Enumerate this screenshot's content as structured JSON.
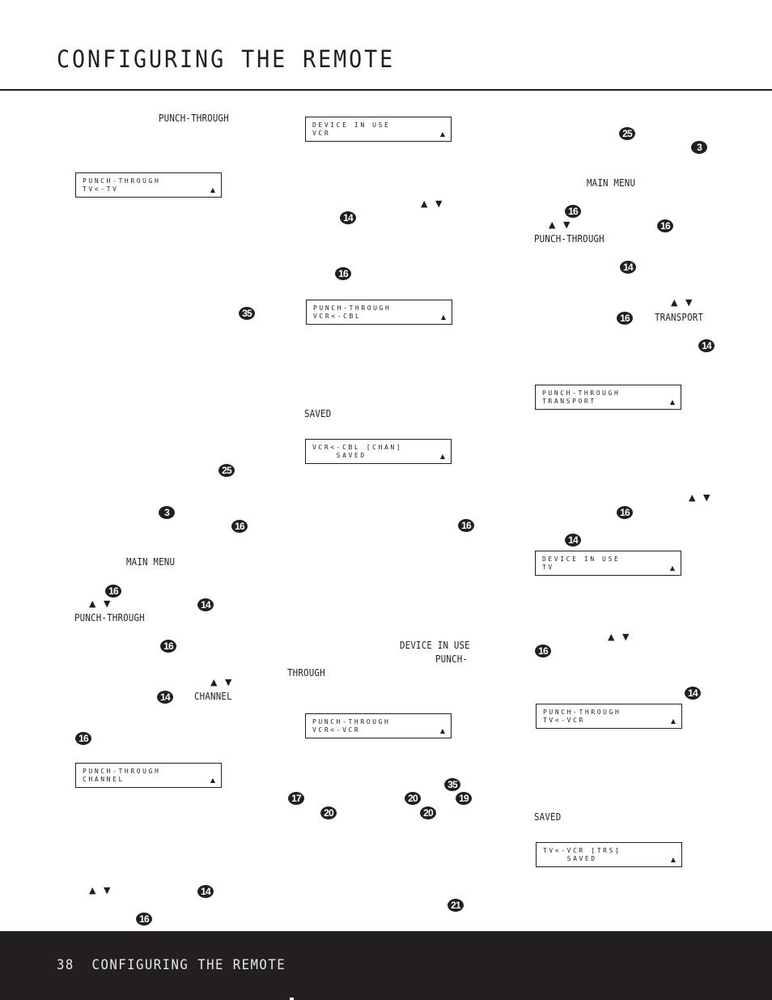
{
  "header": {
    "title": "CONFIGURING THE REMOTE"
  },
  "footer": {
    "page_number": "38",
    "section_title": "CONFIGURING THE REMOTE"
  },
  "text_fragments": [
    "PUNCH-THROUGH",
    "MAIN MENU",
    "PUNCH-THROUGH",
    "CHANNEL",
    "SAVED",
    "DEVICE IN USE",
    "PUNCH-",
    "THROUGH",
    "MAIN MENU",
    "PUNCH-THROUGH",
    "TRANSPORT",
    "SAVED"
  ],
  "arrow_glyphs": "▲ ▼",
  "button_callouts": [
    "35",
    "25",
    "3",
    "16",
    "16",
    "14",
    "16",
    "14",
    "16",
    "14",
    "16",
    "14",
    "16",
    "16",
    "35",
    "17",
    "20",
    "19",
    "20",
    "20",
    "21",
    "25",
    "3",
    "16",
    "16",
    "14",
    "16",
    "14",
    "16",
    "14",
    "16",
    "14",
    "16"
  ],
  "lcd_displays": [
    {
      "line1": "PUNCH-THROUGH",
      "line2": "TV<-TV"
    },
    {
      "line1": "PUNCH-THROUGH",
      "line2": "CHANNEL"
    },
    {
      "line1": "DEVICE IN USE",
      "line2": "VCR"
    },
    {
      "line1": "PUNCH-THROUGH",
      "line2": "VCR<-CBL"
    },
    {
      "line1": "VCR<-CBL [CHAN]",
      "line2": "    SAVED"
    },
    {
      "line1": "PUNCH-THROUGH",
      "line2": "VCR<-VCR"
    },
    {
      "line1": "PUNCH-THROUGH",
      "line2": "TRANSPORT"
    },
    {
      "line1": "DEVICE IN USE",
      "line2": "TV"
    },
    {
      "line1": "PUNCH-THROUGH",
      "line2": "TV<-VCR"
    },
    {
      "line1": "TV<-VCR [TRS]",
      "line2": "    SAVED"
    }
  ],
  "lcd_indicator": "▲"
}
